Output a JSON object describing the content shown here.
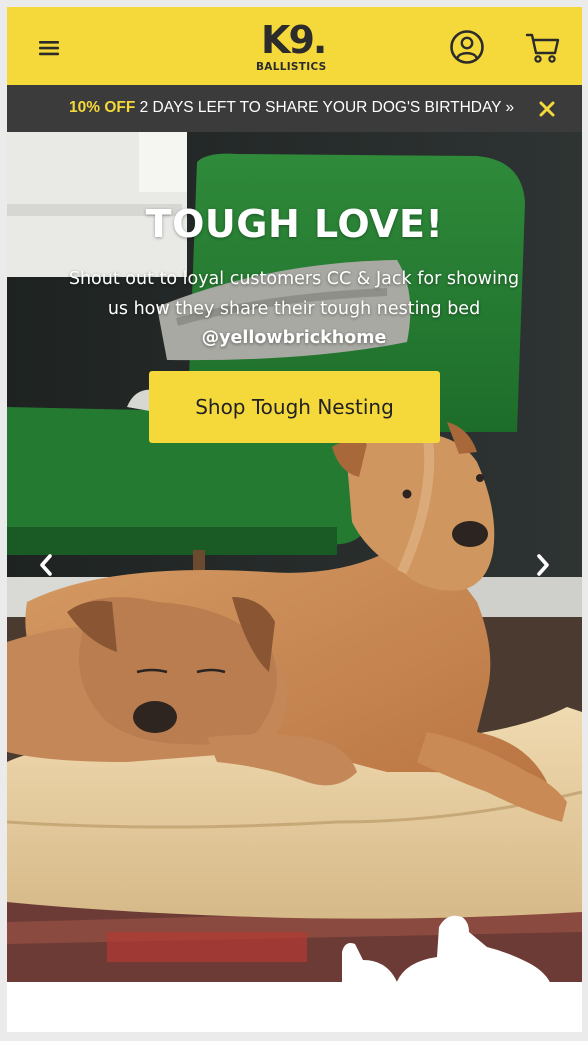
{
  "header": {
    "logo_main": "K9.",
    "logo_sub": "BALLISTICS",
    "menu_icon": "hamburger-menu-icon",
    "account_icon": "user-account-icon",
    "cart_icon": "shopping-cart-icon"
  },
  "promo": {
    "highlight": "10% OFF",
    "message": " 2 DAYS LEFT TO SHARE YOUR DOG'S BIRTHDAY »",
    "close_icon": "close-icon"
  },
  "hero": {
    "title": "TOUGH LOVE!",
    "body_prefix": "Shout out to loyal customers CC & Jack for showing us how they share their tough nesting bed ",
    "handle": "@yellowbrickhome",
    "cta_label": "Shop Tough Nesting",
    "prev_icon": "chevron-left-icon",
    "next_icon": "chevron-right-icon"
  },
  "colors": {
    "brand_yellow": "#f5d93b",
    "promo_bar": "#3b3b3b",
    "text_dark": "#222222"
  }
}
